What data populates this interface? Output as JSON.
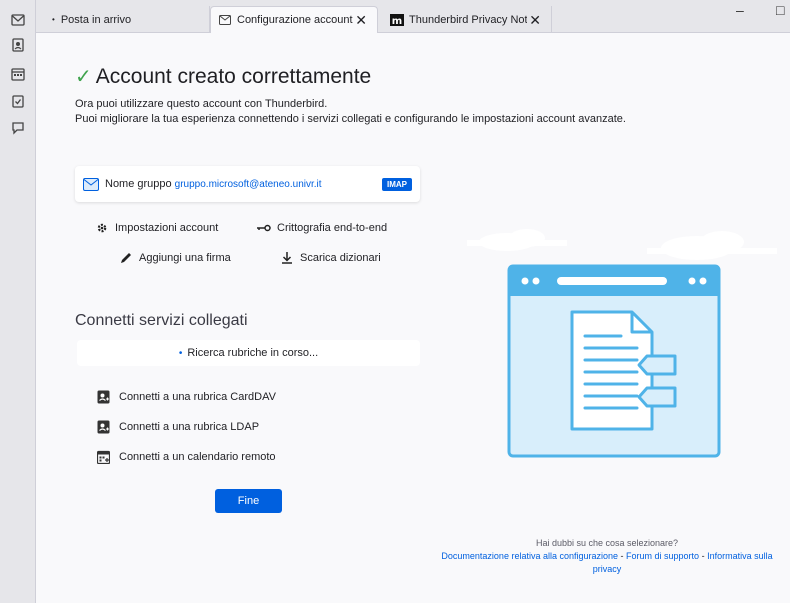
{
  "spaces": [
    "mail-icon",
    "addressbook-icon",
    "calendar-icon",
    "tasks-icon",
    "chat-icon"
  ],
  "tabs": [
    {
      "label": "Posta in arrivo",
      "icon": "dot-icon"
    },
    {
      "label": "Configurazione account",
      "icon": "mail-settings-icon"
    },
    {
      "label": "Thunderbird Privacy Notice",
      "icon": "mozilla-m-icon"
    }
  ],
  "window": {
    "minimize": "–",
    "maximize": "□"
  },
  "success": {
    "title": "Account creato correttamente",
    "line1": "Ora puoi utilizzare questo account con Thunderbird.",
    "line2": "Puoi migliorare la tua esperienza connettendo i servizi collegati e configurando le impostazioni account avanzate."
  },
  "account": {
    "name": "Nome gruppo",
    "email": "gruppo.microsoft@ateneo.univr.it",
    "badge": "IMAP"
  },
  "actions": {
    "settings": "Impostazioni account",
    "e2e": "Crittografia end-to-end",
    "signature": "Aggiungi una firma",
    "dictionaries": "Scarica dizionari"
  },
  "linked": {
    "title": "Connetti servizi collegati",
    "searching": "Ricerca rubriche in corso...",
    "carddav": "Connetti a una rubrica CardDAV",
    "ldap": "Connetti a una rubrica LDAP",
    "calendar": "Connetti a un calendario remoto"
  },
  "finish": "Fine",
  "help": {
    "question": "Hai dubbi su che cosa selezionare?",
    "doc": "Documentazione relativa alla configurazione",
    "sep1": " - ",
    "forum": "Forum di supporto",
    "sep2": " - ",
    "privacy": "Informativa sulla privacy"
  },
  "colors": {
    "accent": "#0060df",
    "success": "#3fa34d",
    "illustration": "#4fb3e8"
  }
}
